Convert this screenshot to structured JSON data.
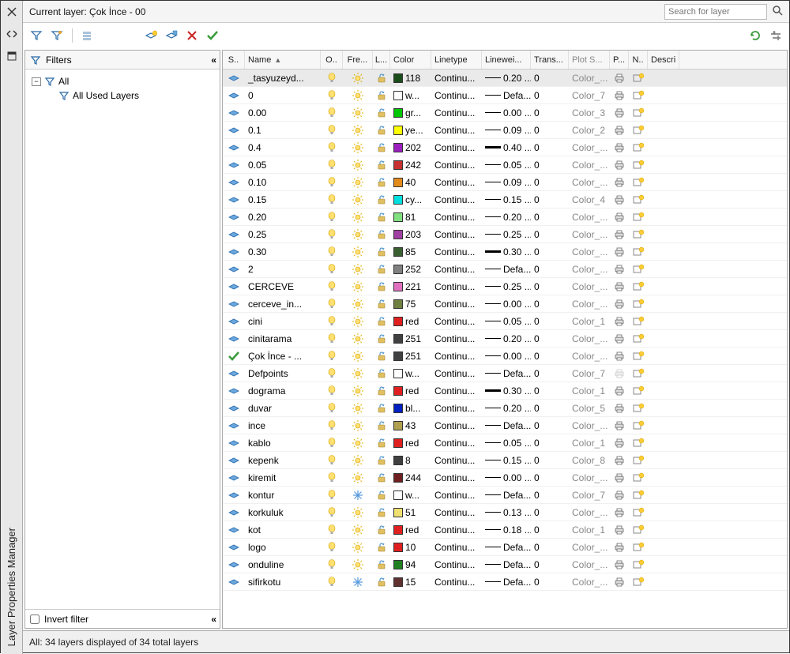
{
  "palette": {
    "title": "Layer Properties Manager"
  },
  "header": {
    "current_layer_label": "Current layer: Çok İnce - 00",
    "search_placeholder": "Search for layer"
  },
  "filters": {
    "title": "Filters",
    "tree": {
      "root": "All",
      "child": "All Used Layers"
    },
    "invert_label": "Invert filter"
  },
  "columns": {
    "status": "S..",
    "name": "Name",
    "on": "O..",
    "freeze": "Fre...",
    "lock": "L...",
    "color": "Color",
    "linetype": "Linetype",
    "lineweight": "Linewei...",
    "trans": "Trans...",
    "plotstyle": "Plot S...",
    "plot": "P...",
    "newvp": "N..",
    "descr": "Descri"
  },
  "rows": [
    {
      "name": "_tasyuzeyd...",
      "freeze": "sun",
      "color": "#1a4d1a",
      "colorLabel": "118",
      "linetype": "Continu...",
      "lw": "0.20 ...",
      "lwThick": false,
      "trans": "0",
      "plotstyle": "Color_...",
      "plot": true,
      "current": false,
      "selected": true
    },
    {
      "name": "0",
      "freeze": "sun",
      "color": "#ffffff",
      "colorLabel": "w...",
      "linetype": "Continu...",
      "lw": "Defa...",
      "lwThick": false,
      "trans": "0",
      "plotstyle": "Color_7",
      "plot": true,
      "current": false
    },
    {
      "name": "0.00",
      "freeze": "sun",
      "color": "#00c800",
      "colorLabel": "gr...",
      "linetype": "Continu...",
      "lw": "0.00 ...",
      "lwThick": false,
      "trans": "0",
      "plotstyle": "Color_3",
      "plot": true,
      "current": false
    },
    {
      "name": "0.1",
      "freeze": "sun",
      "color": "#ffff00",
      "colorLabel": "ye...",
      "linetype": "Continu...",
      "lw": "0.09 ...",
      "lwThick": false,
      "trans": "0",
      "plotstyle": "Color_2",
      "plot": true,
      "current": false
    },
    {
      "name": "0.4",
      "freeze": "sun",
      "color": "#9b1fbf",
      "colorLabel": "202",
      "linetype": "Continu...",
      "lw": "0.40 ...",
      "lwThick": true,
      "trans": "0",
      "plotstyle": "Color_...",
      "plot": true,
      "current": false
    },
    {
      "name": "0.05",
      "freeze": "sun",
      "color": "#c83030",
      "colorLabel": "242",
      "linetype": "Continu...",
      "lw": "0.05 ...",
      "lwThick": false,
      "trans": "0",
      "plotstyle": "Color_...",
      "plot": true,
      "current": false
    },
    {
      "name": "0.10",
      "freeze": "sun",
      "color": "#e28a1a",
      "colorLabel": "40",
      "linetype": "Continu...",
      "lw": "0.09 ...",
      "lwThick": false,
      "trans": "0",
      "plotstyle": "Color_...",
      "plot": true,
      "current": false
    },
    {
      "name": "0.15",
      "freeze": "sun",
      "color": "#00e0e0",
      "colorLabel": "cy...",
      "linetype": "Continu...",
      "lw": "0.15 ...",
      "lwThick": false,
      "trans": "0",
      "plotstyle": "Color_4",
      "plot": true,
      "current": false
    },
    {
      "name": "0.20",
      "freeze": "sun",
      "color": "#80e080",
      "colorLabel": "81",
      "linetype": "Continu...",
      "lw": "0.20 ...",
      "lwThick": false,
      "trans": "0",
      "plotstyle": "Color_...",
      "plot": true,
      "current": false
    },
    {
      "name": "0.25",
      "freeze": "sun",
      "color": "#a040a0",
      "colorLabel": "203",
      "linetype": "Continu...",
      "lw": "0.25 ...",
      "lwThick": false,
      "trans": "0",
      "plotstyle": "Color_...",
      "plot": true,
      "current": false
    },
    {
      "name": "0.30",
      "freeze": "sun",
      "color": "#3a6030",
      "colorLabel": "85",
      "linetype": "Continu...",
      "lw": "0.30 ...",
      "lwThick": true,
      "trans": "0",
      "plotstyle": "Color_...",
      "plot": true,
      "current": false
    },
    {
      "name": "2",
      "freeze": "sun",
      "color": "#808080",
      "colorLabel": "252",
      "linetype": "Continu...",
      "lw": "Defa...",
      "lwThick": false,
      "trans": "0",
      "plotstyle": "Color_...",
      "plot": true,
      "current": false
    },
    {
      "name": "CERCEVE",
      "freeze": "sun",
      "color": "#e070c0",
      "colorLabel": "221",
      "linetype": "Continu...",
      "lw": "0.25 ...",
      "lwThick": false,
      "trans": "0",
      "plotstyle": "Color_...",
      "plot": true,
      "current": false
    },
    {
      "name": "cerceve_in...",
      "freeze": "sun",
      "color": "#708040",
      "colorLabel": "75",
      "linetype": "Continu...",
      "lw": "0.00 ...",
      "lwThick": false,
      "trans": "0",
      "plotstyle": "Color_...",
      "plot": true,
      "current": false
    },
    {
      "name": "cini",
      "freeze": "sun",
      "color": "#e02020",
      "colorLabel": "red",
      "linetype": "Continu...",
      "lw": "0.05 ...",
      "lwThick": false,
      "trans": "0",
      "plotstyle": "Color_1",
      "plot": true,
      "current": false
    },
    {
      "name": "cinitarama",
      "freeze": "sun",
      "color": "#404040",
      "colorLabel": "251",
      "linetype": "Continu...",
      "lw": "0.20 ...",
      "lwThick": false,
      "trans": "0",
      "plotstyle": "Color_...",
      "plot": true,
      "current": false
    },
    {
      "name": "Çok İnce - ...",
      "freeze": "sun",
      "color": "#404040",
      "colorLabel": "251",
      "linetype": "Continu...",
      "lw": "0.00 ...",
      "lwThick": false,
      "trans": "0",
      "plotstyle": "Color_...",
      "plot": true,
      "current": true
    },
    {
      "name": "Defpoints",
      "freeze": "sun",
      "color": "#ffffff",
      "colorLabel": "w...",
      "linetype": "Continu...",
      "lw": "Defa...",
      "lwThick": false,
      "trans": "0",
      "plotstyle": "Color_7",
      "plot": false,
      "current": false
    },
    {
      "name": "dograma",
      "freeze": "sun",
      "color": "#e02020",
      "colorLabel": "red",
      "linetype": "Continu...",
      "lw": "0.30 ...",
      "lwThick": true,
      "trans": "0",
      "plotstyle": "Color_1",
      "plot": true,
      "current": false
    },
    {
      "name": "duvar",
      "freeze": "sun",
      "color": "#0020c0",
      "colorLabel": "bl...",
      "linetype": "Continu...",
      "lw": "0.20 ...",
      "lwThick": false,
      "trans": "0",
      "plotstyle": "Color_5",
      "plot": true,
      "current": false
    },
    {
      "name": "ince",
      "freeze": "sun",
      "color": "#b0a050",
      "colorLabel": "43",
      "linetype": "Continu...",
      "lw": "Defa...",
      "lwThick": false,
      "trans": "0",
      "plotstyle": "Color_...",
      "plot": true,
      "current": false
    },
    {
      "name": "kablo",
      "freeze": "sun",
      "color": "#e02020",
      "colorLabel": "red",
      "linetype": "Continu...",
      "lw": "0.05 ...",
      "lwThick": false,
      "trans": "0",
      "plotstyle": "Color_1",
      "plot": true,
      "current": false
    },
    {
      "name": "kepenk",
      "freeze": "sun",
      "color": "#404040",
      "colorLabel": "8",
      "linetype": "Continu...",
      "lw": "0.15 ...",
      "lwThick": false,
      "trans": "0",
      "plotstyle": "Color_8",
      "plot": true,
      "current": false
    },
    {
      "name": "kiremit",
      "freeze": "sun",
      "color": "#702020",
      "colorLabel": "244",
      "linetype": "Continu...",
      "lw": "0.00 ...",
      "lwThick": false,
      "trans": "0",
      "plotstyle": "Color_...",
      "plot": true,
      "current": false
    },
    {
      "name": "kontur",
      "freeze": "snow",
      "color": "#ffffff",
      "colorLabel": "w...",
      "linetype": "Continu...",
      "lw": "Defa...",
      "lwThick": false,
      "trans": "0",
      "plotstyle": "Color_7",
      "plot": true,
      "current": false
    },
    {
      "name": "korkuluk",
      "freeze": "sun",
      "color": "#f0e070",
      "colorLabel": "51",
      "linetype": "Continu...",
      "lw": "0.13 ...",
      "lwThick": false,
      "trans": "0",
      "plotstyle": "Color_...",
      "plot": true,
      "current": false
    },
    {
      "name": "kot",
      "freeze": "sun",
      "color": "#e02020",
      "colorLabel": "red",
      "linetype": "Continu...",
      "lw": "0.18 ...",
      "lwThick": false,
      "trans": "0",
      "plotstyle": "Color_1",
      "plot": true,
      "current": false
    },
    {
      "name": "logo",
      "freeze": "sun",
      "color": "#e02020",
      "colorLabel": "10",
      "linetype": "Continu...",
      "lw": "Defa...",
      "lwThick": false,
      "trans": "0",
      "plotstyle": "Color_...",
      "plot": true,
      "current": false
    },
    {
      "name": "onduline",
      "freeze": "sun",
      "color": "#208020",
      "colorLabel": "94",
      "linetype": "Continu...",
      "lw": "Defa...",
      "lwThick": false,
      "trans": "0",
      "plotstyle": "Color_...",
      "plot": true,
      "current": false
    },
    {
      "name": "sifirkotu",
      "freeze": "snow",
      "color": "#603030",
      "colorLabel": "15",
      "linetype": "Continu...",
      "lw": "Defa...",
      "lwThick": false,
      "trans": "0",
      "plotstyle": "Color_...",
      "plot": true,
      "current": false
    }
  ],
  "status_bar": "All: 34 layers displayed of 34 total layers"
}
